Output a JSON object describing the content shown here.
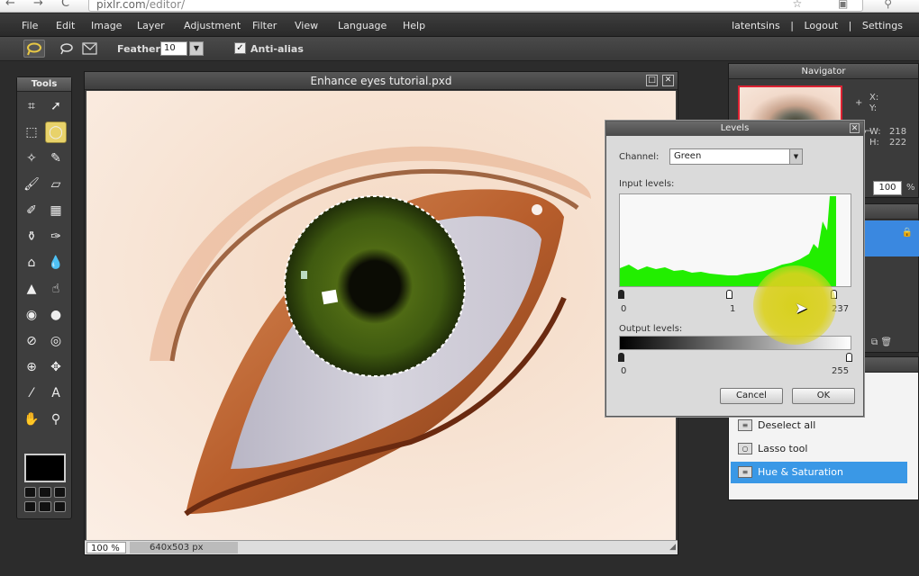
{
  "browser": {
    "url_host": "pixlr.com",
    "url_path": "/editor/"
  },
  "menu": {
    "items": [
      "File",
      "Edit",
      "Image",
      "Layer",
      "Adjustment",
      "Filter",
      "View",
      "Language",
      "Help"
    ],
    "user": "latentsins",
    "separator": "|",
    "logout": "Logout",
    "settings": "Settings"
  },
  "options": {
    "feather_label": "Feather:",
    "feather_value": "10",
    "antialias_label": "Anti-alias",
    "antialias_checked": "✓"
  },
  "tools": {
    "title": "Tools",
    "items": [
      "crop-icon",
      "move-icon",
      "marquee-icon",
      "lasso-icon",
      "wand-icon",
      "pencil-icon",
      "brush-icon",
      "eraser-icon",
      "replace-color-icon",
      "gradient-icon",
      "stamp-icon",
      "color-replace-icon",
      "spot-heal-icon",
      "blur-icon",
      "sharpen-icon",
      "smudge-icon",
      "sponge-icon",
      "burn-icon",
      "dodge-icon",
      "red-eye-icon",
      "bloat-icon",
      "pinch-icon",
      "eyedropper-icon",
      "type-icon",
      "hand-icon",
      "zoom-icon"
    ],
    "active": "lasso-icon"
  },
  "document": {
    "title": "Enhance eyes tutorial.pxd",
    "zoom": "100",
    "zoom_unit": "%",
    "size": "640x503 px"
  },
  "navigator": {
    "title": "Navigator",
    "x_label": "X:",
    "y_label": "Y:",
    "w_label": "W:",
    "w_value": "218",
    "h_label": "H:",
    "h_value": "222",
    "zoom_value": "100",
    "zoom_unit": "%"
  },
  "levels": {
    "title": "Levels",
    "channel_label": "Channel:",
    "channel_value": "Green",
    "input_label": "Input levels:",
    "input_values": [
      "0",
      "1",
      "237"
    ],
    "output_label": "Output levels:",
    "output_values": [
      "0",
      "255"
    ],
    "cancel_label": "Cancel",
    "ok_label": "OK",
    "histogram_color": "#22ee00"
  },
  "history": {
    "items": [
      {
        "label": "Deselect all",
        "icon": "deselect-icon",
        "selected": false
      },
      {
        "label": "Lasso tool",
        "icon": "lasso-icon",
        "selected": false
      },
      {
        "label": "Hue & Saturation",
        "icon": "adjust-icon",
        "selected": true
      }
    ]
  },
  "colors": {
    "accent": "#3a98e6",
    "active_tool": "#e8d26a",
    "cursor_highlight": "#d7d014"
  }
}
